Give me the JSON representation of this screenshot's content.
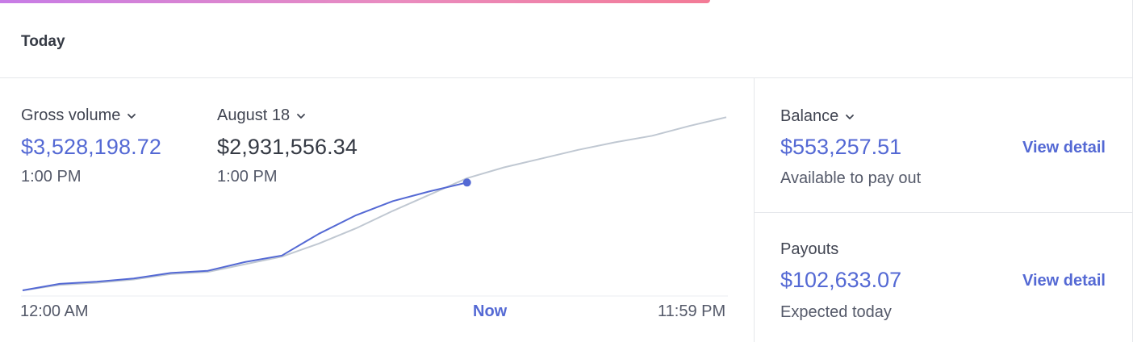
{
  "colors": {
    "accent": "#5469d4",
    "comparison_line": "#c0c8d2",
    "text": "#414552"
  },
  "header": {
    "title": "Today"
  },
  "metrics": {
    "primary": {
      "label": "Gross volume",
      "value": "$3,528,198.72",
      "time": "1:00 PM",
      "icon": "chevron-down-icon"
    },
    "compare": {
      "label": "August 18",
      "value": "$2,931,556.34",
      "time": "1:00 PM",
      "icon": "chevron-down-icon"
    }
  },
  "chart": {
    "x_start": "12:00 AM",
    "x_now": "Now",
    "x_end": "11:59 PM"
  },
  "chart_data": {
    "type": "line",
    "xlabel": "",
    "ylabel": "",
    "grid": false,
    "x_range": [
      "12:00 AM",
      "11:59 PM"
    ],
    "series": [
      {
        "color": "#5469d4",
        "x": [
          0,
          1,
          2,
          3,
          4,
          5,
          6,
          7,
          8,
          9,
          10,
          11,
          12
        ],
        "y": [
          0,
          0.06,
          0.08,
          0.11,
          0.16,
          0.18,
          0.26,
          0.32,
          0.52,
          0.69,
          0.82,
          0.91,
          0.99
        ]
      },
      {
        "color": "#c0c8d2",
        "x": [
          0,
          1,
          2,
          3,
          4,
          5,
          6,
          7,
          8,
          9,
          10,
          11,
          12,
          13,
          14,
          15,
          16,
          17,
          18,
          19
        ],
        "y": [
          0,
          0.05,
          0.07,
          0.1,
          0.15,
          0.17,
          0.24,
          0.31,
          0.43,
          0.57,
          0.73,
          0.88,
          1.03,
          1.13,
          1.21,
          1.29,
          1.36,
          1.42,
          1.51,
          1.59
        ]
      }
    ]
  },
  "side": {
    "balance": {
      "label": "Balance",
      "value": "$553,257.51",
      "sub": "Available to pay out",
      "link": "View detail",
      "icon": "chevron-down-icon"
    },
    "payouts": {
      "label": "Payouts",
      "value": "$102,633.07",
      "sub": "Expected today",
      "link": "View detail"
    }
  }
}
